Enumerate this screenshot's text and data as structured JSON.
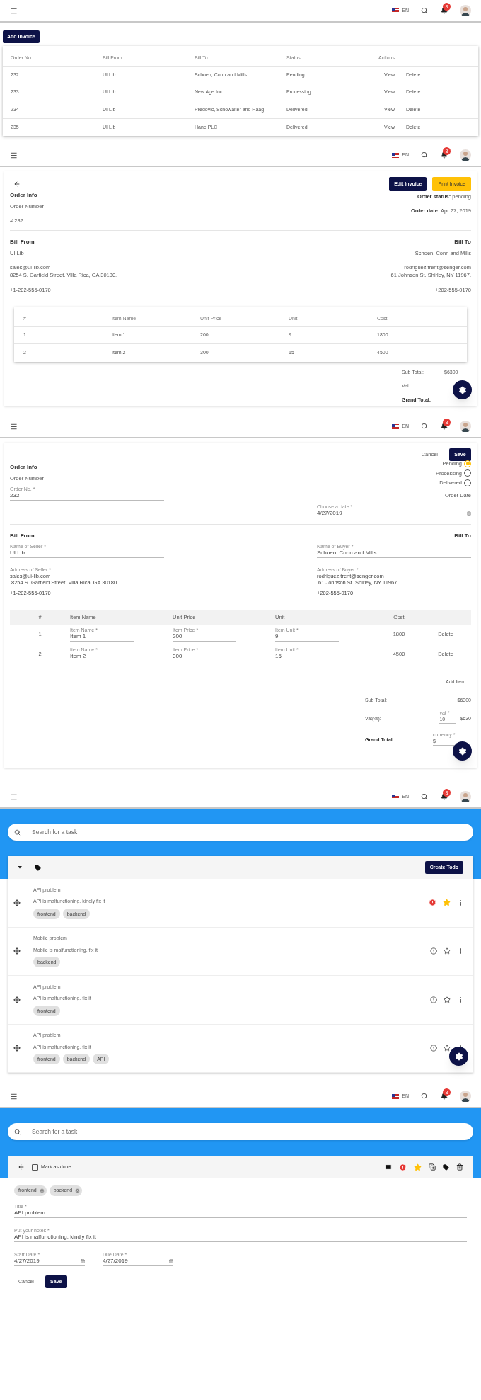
{
  "invoice_list": {
    "header": {
      "language": "EN",
      "notifications": "3"
    },
    "add_button": "Add Invoice",
    "columns": [
      "Order No.",
      "Bill From",
      "Bill To",
      "Status",
      "Actions"
    ],
    "rows": [
      {
        "order_no": "232",
        "bill_from": "UI Lib",
        "bill_to": "Schoen, Conn and Mills",
        "status": "Pending",
        "actions": [
          "View",
          "Delete"
        ]
      },
      {
        "order_no": "233",
        "bill_from": "UI Lib",
        "bill_to": "New Age Inc.",
        "status": "Processing",
        "actions": [
          "View",
          "Delete"
        ]
      },
      {
        "order_no": "234",
        "bill_from": "UI Lib",
        "bill_to": "Predovic, Schowalter and Haag",
        "status": "Delivered",
        "actions": [
          "View",
          "Delete"
        ]
      },
      {
        "order_no": "235",
        "bill_from": "UI Lib",
        "bill_to": "Hane PLC",
        "status": "Delivered",
        "actions": [
          "View",
          "Delete"
        ]
      }
    ]
  },
  "invoice_detail": {
    "header": {
      "language": "EN",
      "notifications": "3"
    },
    "edit_button": "Edit Invoice",
    "print_button": "Print Invoice",
    "order_info_title": "Order Info",
    "order_number_label": "Order Number",
    "order_number": "# 232",
    "status_label": "Order status:",
    "status_value": "pending",
    "date_label": "Order date:",
    "date_value": "Apr 27, 2019",
    "bill_from": {
      "title": "Bill From",
      "name": "UI Lib",
      "email": "sales@ui-lib.com",
      "address": "8254 S. Garfield Street. Villa Rica, GA 30180.",
      "phone": "+1-202-555-0170"
    },
    "bill_to": {
      "title": "Bill To",
      "name": "Schoen, Conn and Mills",
      "email": "rodriguez.trent@senger.com",
      "address": "61 Johnson St. Shirley, NY 11967.",
      "phone": "+202-555-0170"
    },
    "columns": [
      "#",
      "Item Name",
      "Unit Price",
      "Unit",
      "Cost"
    ],
    "items": [
      [
        "1",
        "Item 1",
        "200",
        "9",
        "1800"
      ],
      [
        "2",
        "Item 2",
        "300",
        "15",
        "4500"
      ]
    ],
    "totals": [
      {
        "label": "Sub Total:",
        "value": "$6300",
        "strong": false
      },
      {
        "label": "Vat:",
        "strong": false
      },
      {
        "label": "Grand Total:",
        "strong": true
      }
    ]
  },
  "invoice_edit": {
    "header": {
      "language": "EN",
      "notifications": "3"
    },
    "cancel_button": "Cancel",
    "save_button": "Save",
    "order_info_title": "Order Info",
    "order_number_label": "Order Number",
    "order_no_field": {
      "label": "Order No. *",
      "value": "232"
    },
    "statuses": [
      {
        "label": "Pending",
        "selected": true
      },
      {
        "label": "Processing",
        "selected": false
      },
      {
        "label": "Delivered",
        "selected": false
      }
    ],
    "order_date_title": "Order Date",
    "date_field": {
      "label": "Choose a date *",
      "value": "4/27/2019"
    },
    "bill_from": {
      "title": "Bill From",
      "name_field": {
        "label": "Name of Seller *",
        "value": "UI Lib"
      },
      "address_field": {
        "label": "Address of Seller *",
        "lines": [
          "sales@ui-lib.com",
          "8254 S. Garfield Street. Villa Rica, GA 30180."
        ],
        "phone": "+1-202-555-0170"
      }
    },
    "bill_to": {
      "title": "Bill To",
      "name_field": {
        "label": "Name of Buyer *",
        "value": "Schoen, Conn and Mills"
      },
      "address_field": {
        "label": "Address of Buyer *",
        "lines": [
          "rodriguez.trent@senger.com",
          "61 Johnson St. Shirley, NY 11967."
        ],
        "phone": "+202-555-0170"
      }
    },
    "columns": [
      "#",
      "Item Name",
      "Unit Price",
      "Unit",
      "Cost"
    ],
    "items": [
      {
        "no": "1",
        "name": {
          "label": "Item Name *",
          "value": "Item 1"
        },
        "price": {
          "label": "Item Price *",
          "value": "200"
        },
        "unit": {
          "label": "Item Unit *",
          "value": "9"
        },
        "cost": "1800",
        "delete": "Delete"
      },
      {
        "no": "2",
        "name": {
          "label": "Item Name *",
          "value": "Item 2"
        },
        "price": {
          "label": "Item Price *",
          "value": "300"
        },
        "unit": {
          "label": "Item Unit *",
          "value": "15"
        },
        "cost": "4500",
        "delete": "Delete"
      }
    ],
    "add_item": "Add Item",
    "sub_total": {
      "label": "Sub Total:",
      "value": "$6300"
    },
    "vat": {
      "label": "Vat(%):",
      "field_label": "vat *",
      "field_value": "10",
      "amount": "$630"
    },
    "grand_total": {
      "label": "Grand Total:",
      "field_label": "currency *",
      "field_value": "$"
    }
  },
  "todo_list": {
    "header": {
      "language": "EN",
      "notifications": "3"
    },
    "search_placeholder": "Search for a task",
    "create_button": "Create Todo",
    "todos": [
      {
        "title": "API problem",
        "notes": "API is malfunctioning. kindly fix it",
        "tags": [
          "frontend",
          "backend"
        ],
        "important": true,
        "starred": true
      },
      {
        "title": "Mobile problem",
        "notes": "Mobile is malfunctioning. fix it",
        "tags": [
          "backend"
        ],
        "important": false,
        "starred": false
      },
      {
        "title": "API problem",
        "notes": "API is malfunctioning. fix it",
        "tags": [
          "frontend"
        ],
        "important": false,
        "starred": false
      },
      {
        "title": "API problem",
        "notes": "API is malfunctioning. fix it",
        "tags": [
          "frontend",
          "backend",
          "API"
        ],
        "important": false,
        "starred": false
      }
    ]
  },
  "todo_edit": {
    "header": {
      "language": "EN",
      "notifications": "3"
    },
    "search_placeholder": "Search for a task",
    "mark_done": {
      "label": "Mark as done",
      "checked": false
    },
    "important": true,
    "starred": true,
    "tags": [
      "frontend",
      "backend"
    ],
    "title_field": {
      "label": "Title *",
      "value": "API problem"
    },
    "notes_field": {
      "label": "Put your notes *",
      "value": "API is malfunctioning. kindly fix it"
    },
    "start_date": {
      "label": "Start Date *",
      "value": "4/27/2019"
    },
    "due_date": {
      "label": "Due Date *",
      "value": "4/27/2019"
    },
    "cancel_button": "Cancel",
    "save_button": "Save"
  }
}
